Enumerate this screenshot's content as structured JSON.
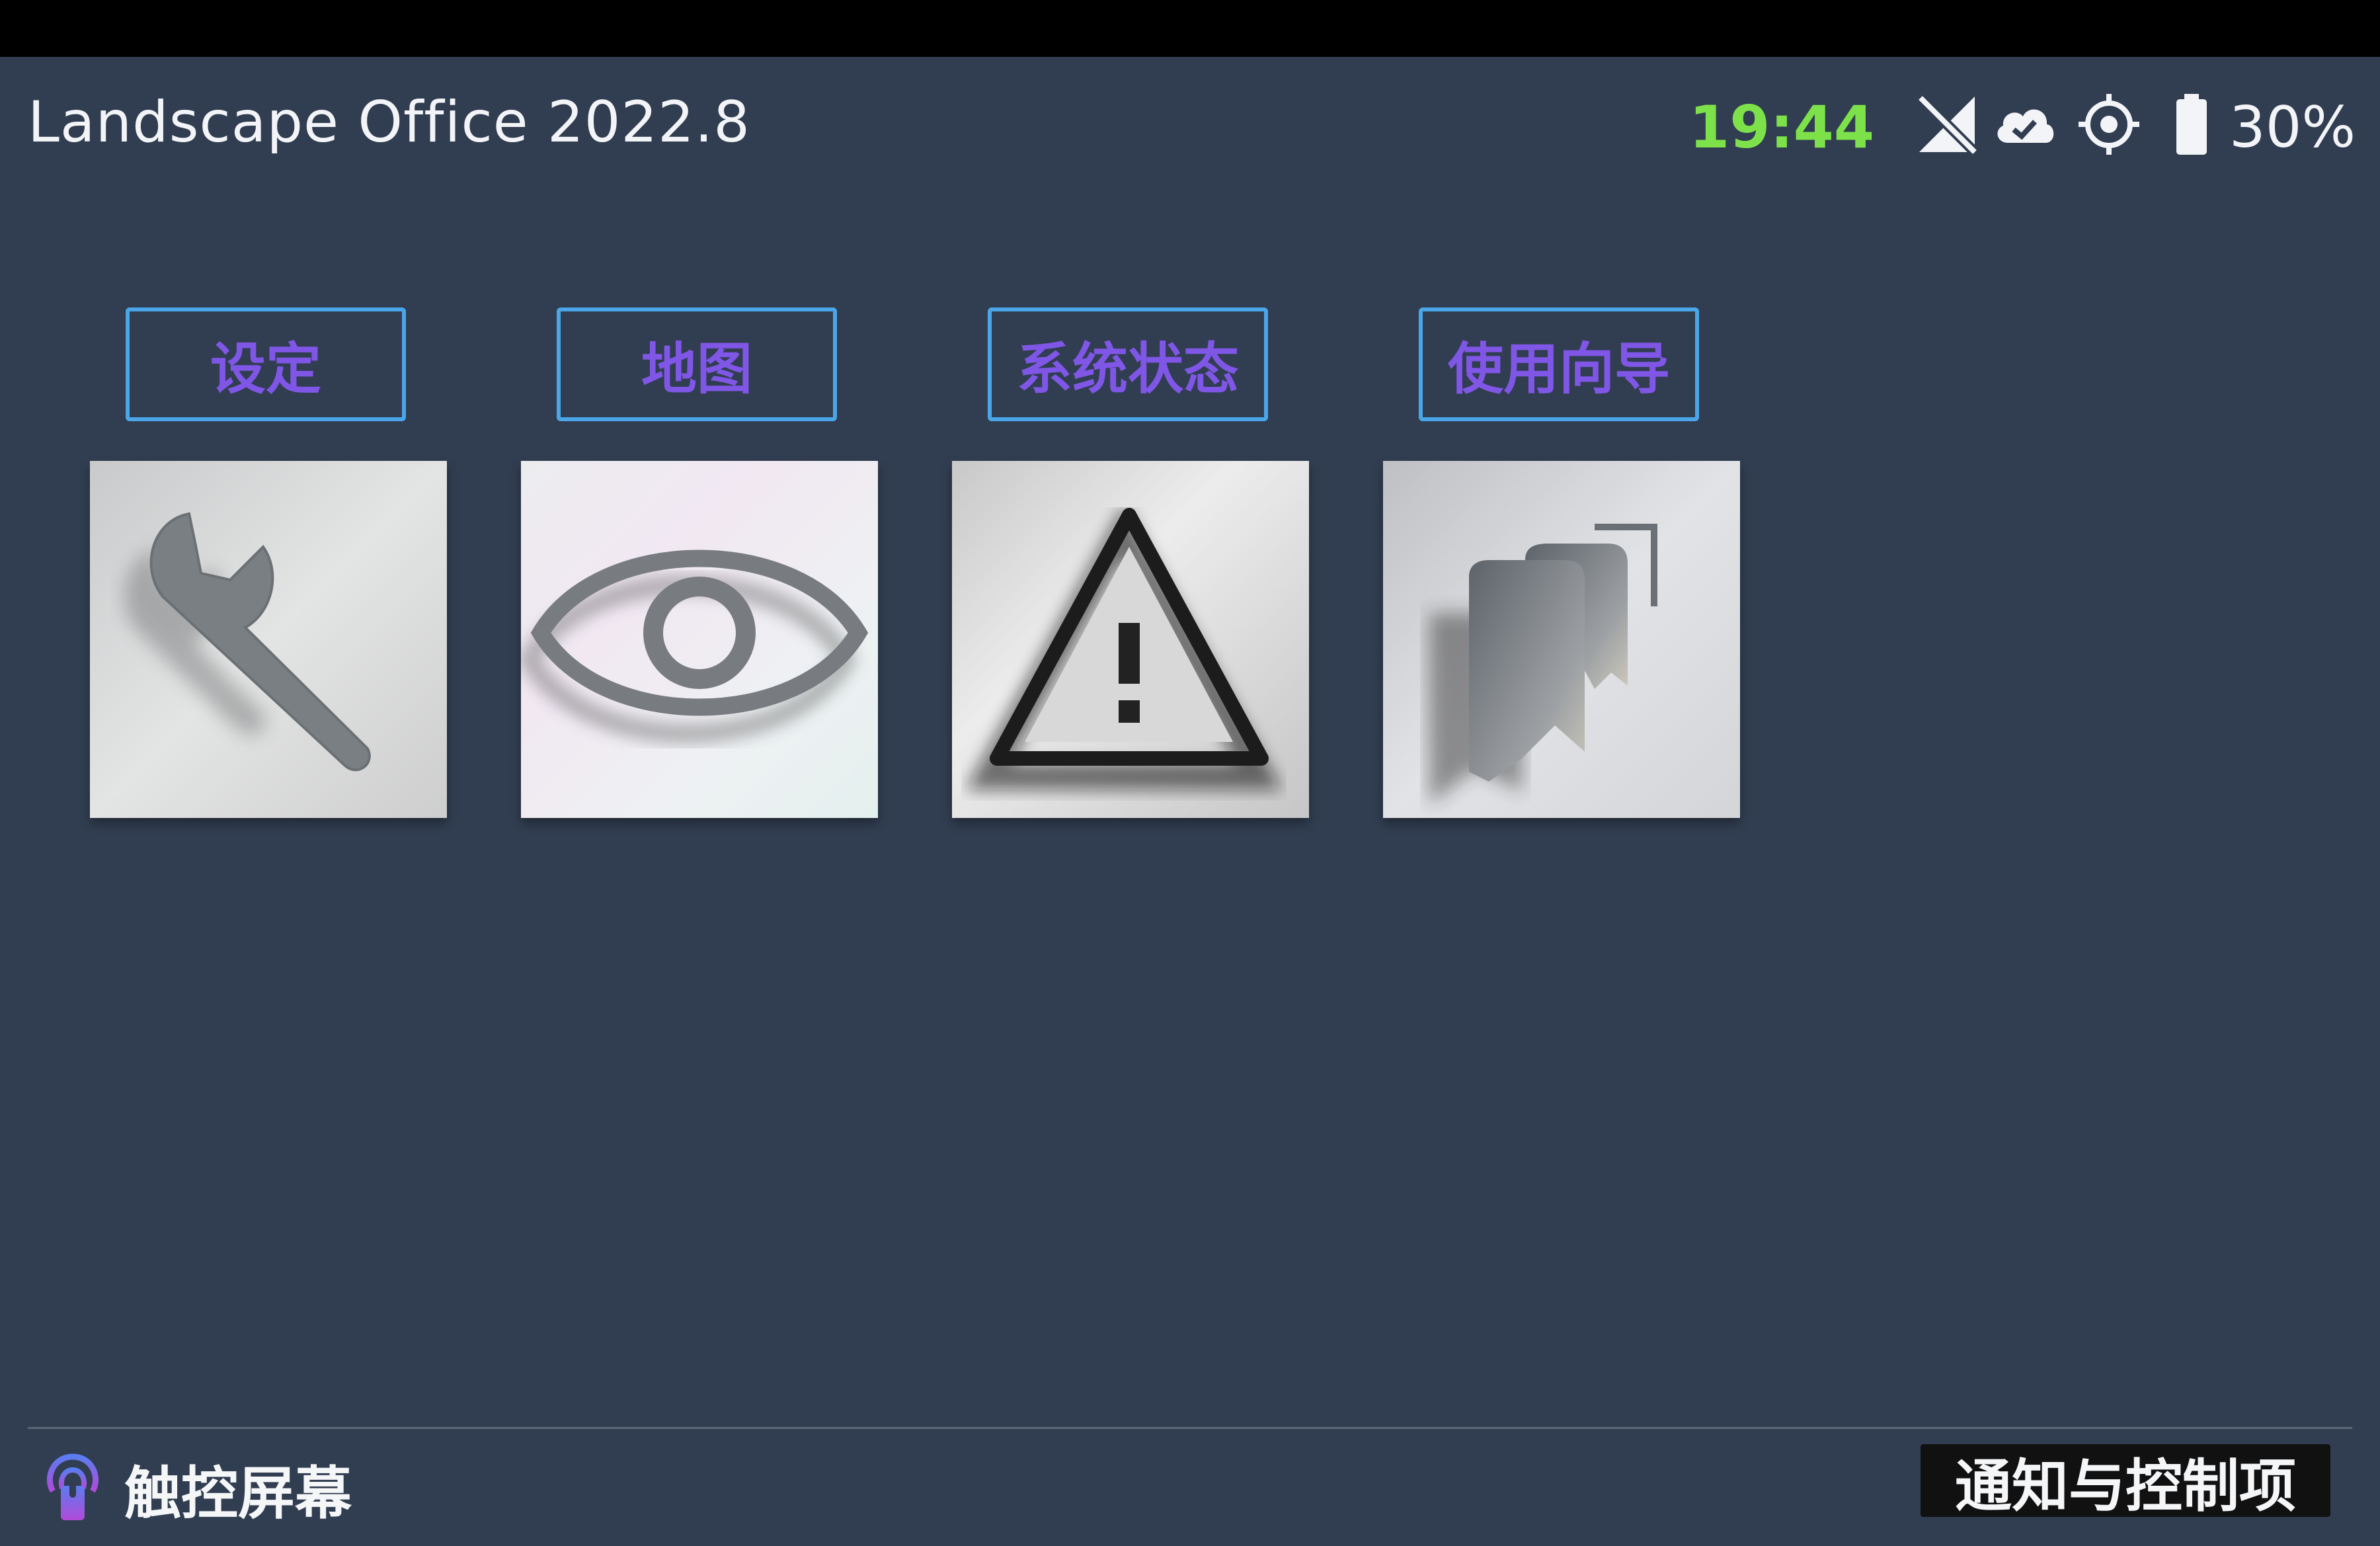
{
  "header": {
    "app_title": "Landscape Office 2022.8",
    "clock": "19:44",
    "battery_percent": "30%",
    "status_icons": [
      "signal-off-icon",
      "cloud-check-icon",
      "gps-target-icon",
      "battery-icon"
    ],
    "clock_color": "#7de24a"
  },
  "tiles": [
    {
      "label": "设定",
      "icon": "wrench-icon"
    },
    {
      "label": "地图",
      "icon": "eye-icon"
    },
    {
      "label": "系统状态",
      "icon": "warning-icon"
    },
    {
      "label": "使用向导",
      "icon": "guide-flags-icon"
    }
  ],
  "footer": {
    "touch_label": "触控屏幕",
    "notifications_button": "通知与控制项"
  },
  "colors": {
    "background": "#313e51",
    "label_border": "#4aa6e8",
    "label_text": "#7f56e6"
  }
}
